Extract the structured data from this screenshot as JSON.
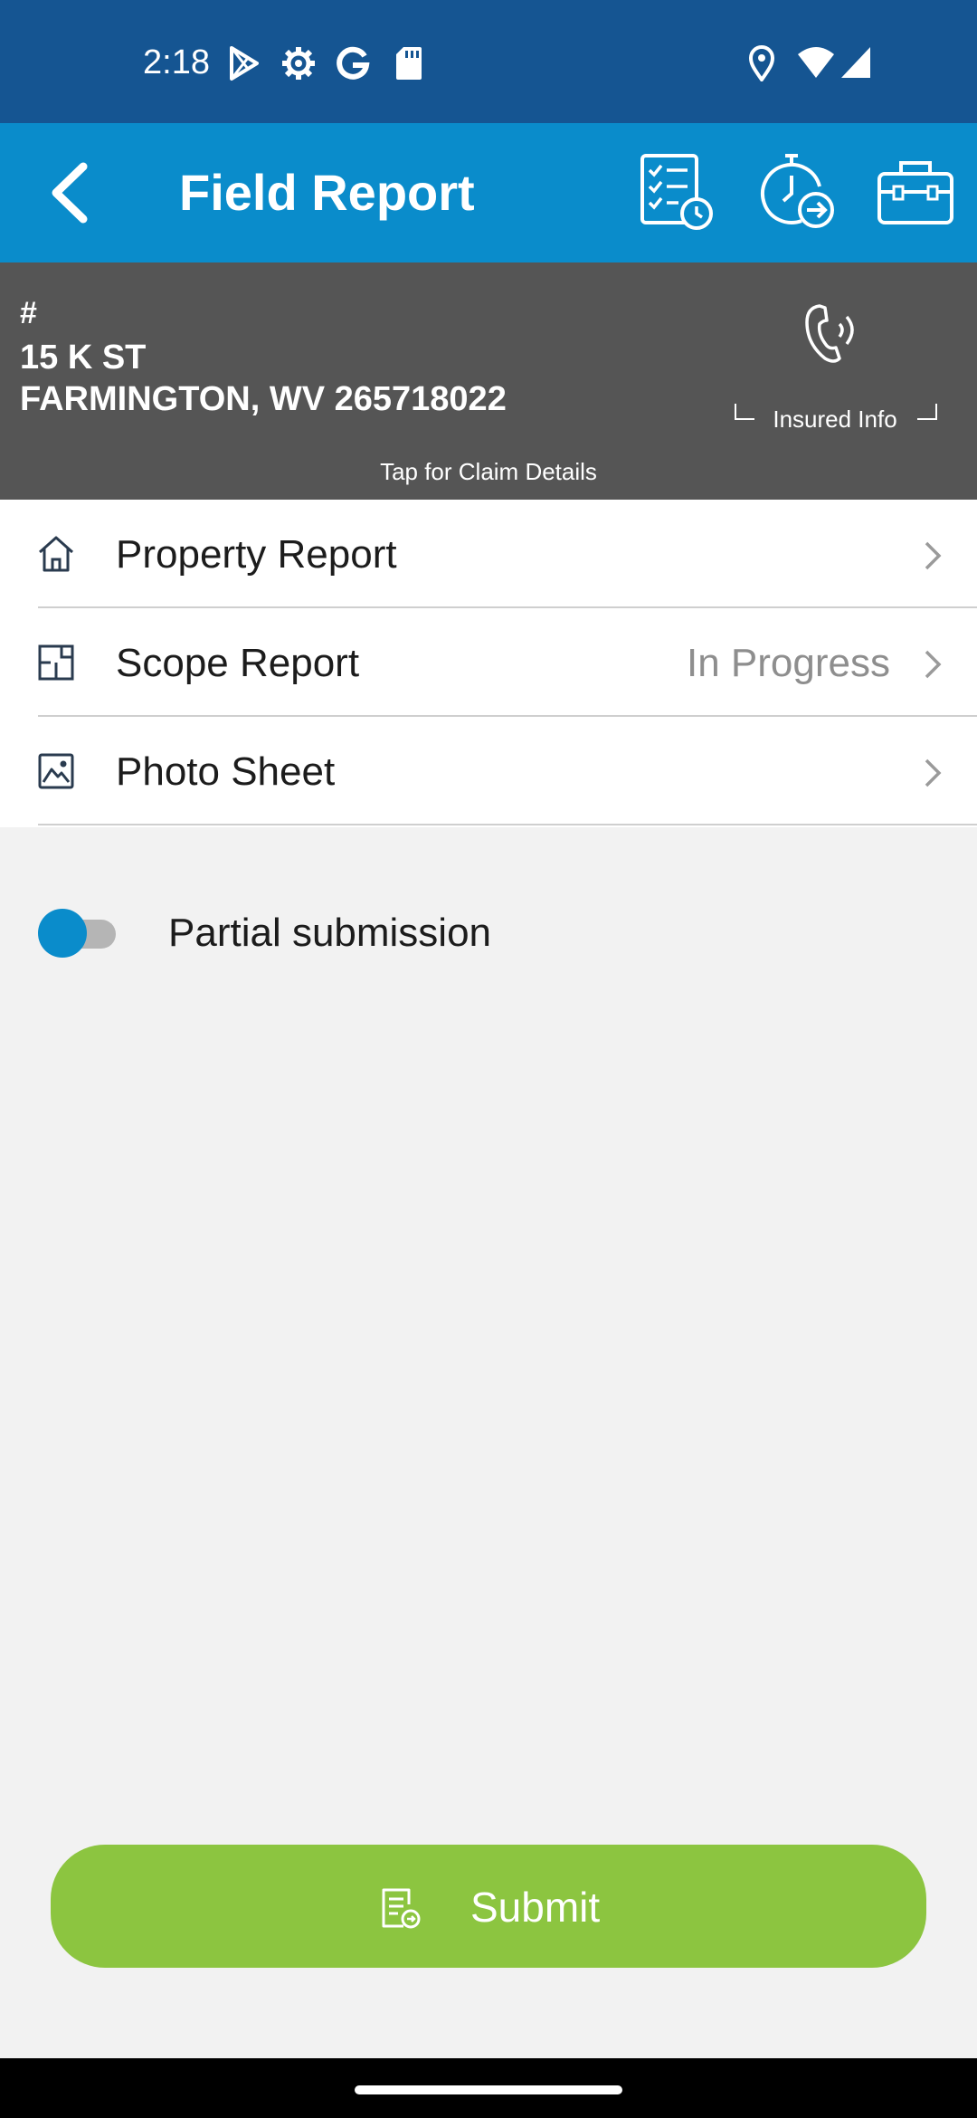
{
  "status_bar": {
    "time": "2:18",
    "left_icons": [
      "play-store-icon",
      "settings-icon",
      "google-icon",
      "sd-card-icon"
    ],
    "right_icons": [
      "location-icon",
      "wifi-icon",
      "signal-icon"
    ]
  },
  "app_bar": {
    "title": "Field Report",
    "actions": [
      "checklist-clock-icon",
      "timer-forward-icon",
      "toolbox-icon"
    ],
    "color": "#0a8ccb"
  },
  "claim": {
    "number": "#",
    "address_line1": "15 K ST",
    "address_line2": "FARMINGTON, WV 265718022",
    "insured_label": "Insured Info",
    "tap_hint": "Tap for Claim Details"
  },
  "menu": {
    "items": [
      {
        "label": "Property Report",
        "status": "",
        "icon": "home-icon"
      },
      {
        "label": "Scope Report",
        "status": "In Progress",
        "icon": "floorplan-icon"
      },
      {
        "label": "Photo Sheet",
        "status": "",
        "icon": "image-icon"
      }
    ]
  },
  "partial_submission": {
    "label": "Partial submission",
    "enabled": false
  },
  "submit": {
    "label": "Submit",
    "color": "#8cc540"
  }
}
